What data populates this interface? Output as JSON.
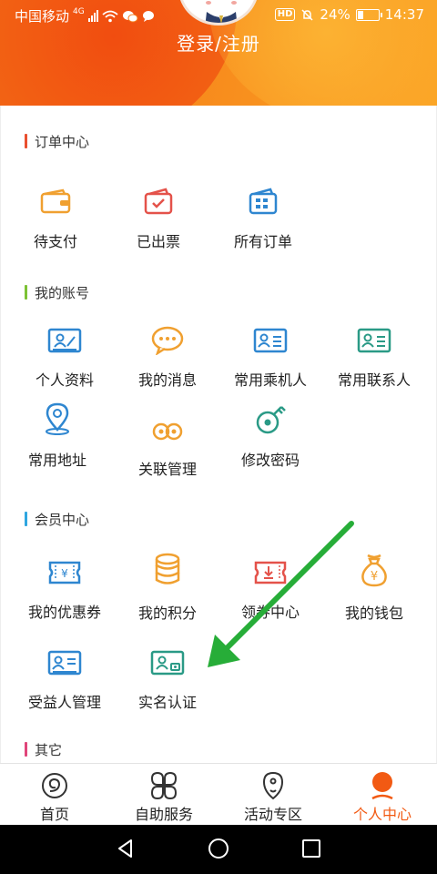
{
  "status_bar": {
    "carrier": "中国移动",
    "network": "4G",
    "battery": "24%",
    "time": "14:37",
    "hd": "HD"
  },
  "header": {
    "login_label": "登录/注册"
  },
  "sections": {
    "orders": {
      "title": "订单中心",
      "accent": "#e94f2f",
      "items": [
        {
          "label": "待支付",
          "icon": "wallet-icon"
        },
        {
          "label": "已出票",
          "icon": "ticket-check-icon"
        },
        {
          "label": "所有订单",
          "icon": "order-list-icon"
        }
      ]
    },
    "account": {
      "title": "我的账号",
      "accent": "#7cc234",
      "items": [
        {
          "label": "个人资料",
          "icon": "profile-card-icon"
        },
        {
          "label": "我的消息",
          "icon": "message-bubble-icon"
        },
        {
          "label": "常用乘机人",
          "icon": "passenger-card-icon"
        },
        {
          "label": "常用联系人",
          "icon": "contact-card-icon"
        },
        {
          "label": "常用地址",
          "icon": "location-pin-icon"
        },
        {
          "label": "关联管理",
          "icon": "link-rings-icon"
        },
        {
          "label": "修改密码",
          "icon": "key-icon"
        }
      ]
    },
    "member": {
      "title": "会员中心",
      "accent": "#2fa6e0",
      "items": [
        {
          "label": "我的优惠券",
          "icon": "coupon-icon"
        },
        {
          "label": "我的积分",
          "icon": "points-coins-icon"
        },
        {
          "label": "领券中心",
          "icon": "coupon-download-icon"
        },
        {
          "label": "我的钱包",
          "icon": "money-bag-icon"
        },
        {
          "label": "受益人管理",
          "icon": "beneficiary-card-icon"
        },
        {
          "label": "实名认证",
          "icon": "id-verify-icon"
        }
      ]
    },
    "other": {
      "title": "其它",
      "accent": "#e0457a"
    }
  },
  "tabbar": {
    "tabs": [
      {
        "label": "首页",
        "icon": "home-icon"
      },
      {
        "label": "自助服务",
        "icon": "self-service-icon"
      },
      {
        "label": "活动专区",
        "icon": "activity-icon"
      },
      {
        "label": "个人中心",
        "icon": "profile-icon"
      }
    ],
    "active_color": "#f25a13"
  },
  "colors": {
    "orange": "#f0a030",
    "red": "#e4524a",
    "blue": "#2e86d0",
    "teal": "#2a9a86"
  }
}
